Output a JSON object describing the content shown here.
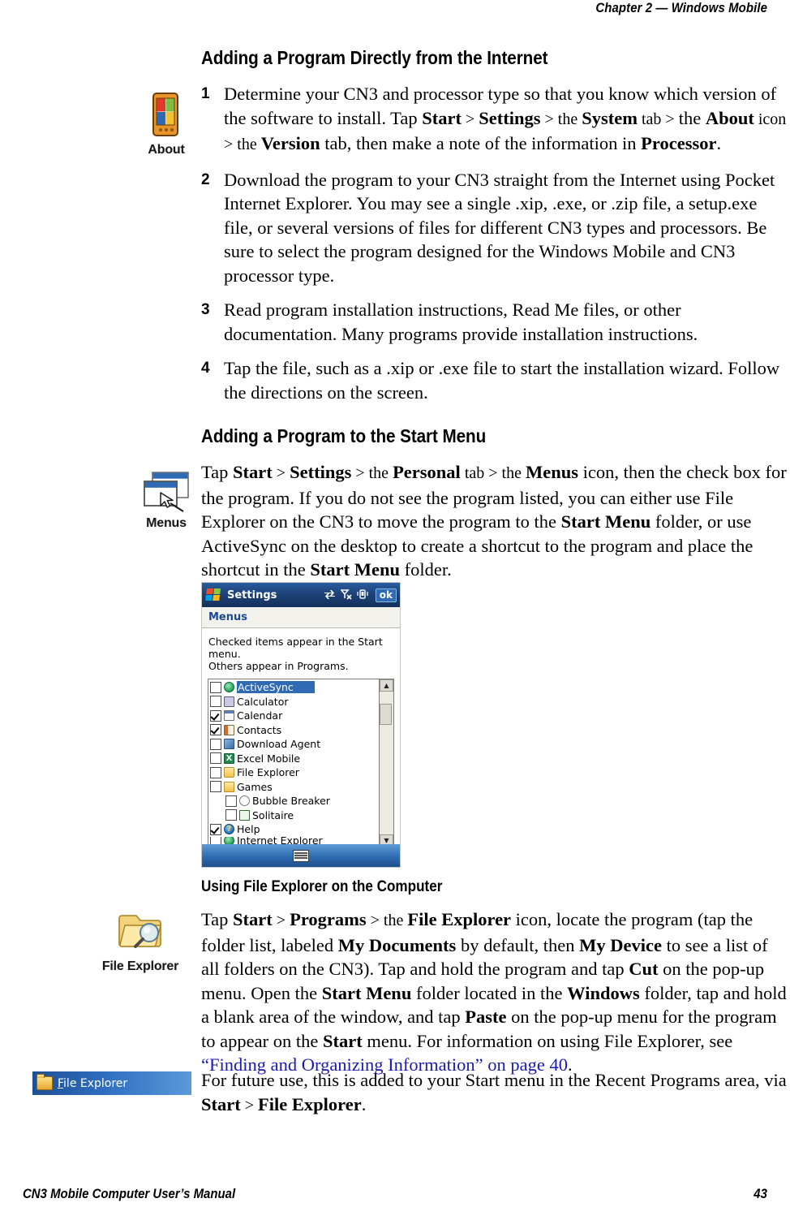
{
  "page": {
    "running_head": "Chapter 2 —  Windows Mobile",
    "footer_title": "CN3 Mobile Computer User’s Manual",
    "footer_page": "43"
  },
  "section1": {
    "heading": "Adding a Program Directly from the Internet",
    "icon_caption": "About",
    "steps": [
      {
        "num": "1",
        "parts": [
          {
            "t": "Determine your CN3 and processor type so that you know which version of the software to install. Tap ",
            "s": "normal"
          },
          {
            "t": "Start",
            "s": "bold"
          },
          {
            "t": " > ",
            "s": "gt"
          },
          {
            "t": "Settings",
            "s": "bold"
          },
          {
            "t": " > the ",
            "s": "gt"
          },
          {
            "t": "System",
            "s": "bold"
          },
          {
            "t": " tab > ",
            "s": "gt"
          },
          {
            "t": "the ",
            "s": "normal"
          },
          {
            "t": "About",
            "s": "bold"
          },
          {
            "t": " icon > the ",
            "s": "gt"
          },
          {
            "t": "Version",
            "s": "bold"
          },
          {
            "t": " tab, then make a note of the information in ",
            "s": "normal"
          },
          {
            "t": "Processor",
            "s": "bold"
          },
          {
            "t": ".",
            "s": "normal"
          }
        ]
      },
      {
        "num": "2",
        "parts": [
          {
            "t": "Download the program to your CN3 straight from the Internet using Pocket Internet Explorer. You may see a single .xip, .exe, or .zip file, a setup.exe file, or several versions of files for different CN3 types and processors. Be sure to select the program designed for the Windows Mobile and CN3 processor type.",
            "s": "normal"
          }
        ]
      },
      {
        "num": "3",
        "parts": [
          {
            "t": "Read program installation instructions, Read Me files, or other documentation. Many programs provide installation instructions.",
            "s": "normal"
          }
        ]
      },
      {
        "num": "4",
        "parts": [
          {
            "t": "Tap the file, such as a .xip or .exe file to start the installation wizard. Follow the directions on the screen.",
            "s": "normal"
          }
        ]
      }
    ]
  },
  "section2": {
    "heading": "Adding a Program to the Start Menu",
    "icon_caption": "Menus",
    "paragraph": [
      {
        "t": "Tap ",
        "s": "normal"
      },
      {
        "t": "Start",
        "s": "bold"
      },
      {
        "t": " > ",
        "s": "gt"
      },
      {
        "t": "Settings",
        "s": "bold"
      },
      {
        "t": " > the ",
        "s": "gt"
      },
      {
        "t": "Personal",
        "s": "bold"
      },
      {
        "t": " tab > the ",
        "s": "gt"
      },
      {
        "t": "Menus",
        "s": "bold"
      },
      {
        "t": " icon, then the check box for the program. If you do not see the program listed, you can either use File Explorer on the CN3 to move the program to the ",
        "s": "normal"
      },
      {
        "t": "Start Menu",
        "s": "bold"
      },
      {
        "t": " folder, or use ActiveSync on the desktop to create a shortcut to the program and place the shortcut in the ",
        "s": "normal"
      },
      {
        "t": "Start Menu",
        "s": "bold"
      },
      {
        "t": " folder.",
        "s": "normal"
      }
    ]
  },
  "pocketpc": {
    "title": "Settings",
    "ok_label": "ok",
    "tray_icons": [
      "activesync-icon",
      "signal-off-icon",
      "volume-icon"
    ],
    "subhead": "Menus",
    "instruction_line1": "Checked items appear in the Start menu.",
    "instruction_line2": "Others appear in Programs.",
    "scroll_up": "▲",
    "scroll_down": "▼",
    "items": [
      {
        "label": "ActiveSync",
        "checked": false,
        "selected": true,
        "indent": false,
        "icon": "ic-activesync",
        "glyph": ""
      },
      {
        "label": "Calculator",
        "checked": false,
        "selected": false,
        "indent": false,
        "icon": "ic-calculator",
        "glyph": ""
      },
      {
        "label": "Calendar",
        "checked": true,
        "selected": false,
        "indent": false,
        "icon": "ic-calendar",
        "glyph": ""
      },
      {
        "label": "Contacts",
        "checked": true,
        "selected": false,
        "indent": false,
        "icon": "ic-contacts",
        "glyph": ""
      },
      {
        "label": "Download Agent",
        "checked": false,
        "selected": false,
        "indent": false,
        "icon": "ic-download",
        "glyph": ""
      },
      {
        "label": "Excel Mobile",
        "checked": false,
        "selected": false,
        "indent": false,
        "icon": "ic-excel",
        "glyph": "X"
      },
      {
        "label": "File Explorer",
        "checked": false,
        "selected": false,
        "indent": false,
        "icon": "ic-folder",
        "glyph": ""
      },
      {
        "label": "Games",
        "checked": false,
        "selected": false,
        "indent": false,
        "icon": "ic-games",
        "glyph": ""
      },
      {
        "label": "Bubble Breaker",
        "checked": false,
        "selected": false,
        "indent": true,
        "icon": "ic-bubble",
        "glyph": ""
      },
      {
        "label": "Solitaire",
        "checked": false,
        "selected": false,
        "indent": true,
        "icon": "ic-solitaire",
        "glyph": ""
      },
      {
        "label": "Help",
        "checked": true,
        "selected": false,
        "indent": false,
        "icon": "ic-help",
        "glyph": "?"
      },
      {
        "label": "Internet Explorer",
        "checked": false,
        "selected": false,
        "indent": false,
        "icon": "ic-activesync",
        "glyph": "",
        "clipped": true
      }
    ]
  },
  "section3": {
    "heading": "Using File Explorer on the Computer",
    "icon_caption": "File Explorer",
    "paragraph": [
      {
        "t": "Tap ",
        "s": "normal"
      },
      {
        "t": "Start",
        "s": "bold"
      },
      {
        "t": " > ",
        "s": "gt"
      },
      {
        "t": "Programs",
        "s": "bold"
      },
      {
        "t": " > the ",
        "s": "gt"
      },
      {
        "t": "File Explorer",
        "s": "bold"
      },
      {
        "t": " icon, locate the program (tap the folder list, labeled ",
        "s": "normal"
      },
      {
        "t": "My Documents",
        "s": "bold"
      },
      {
        "t": " by default, then ",
        "s": "normal"
      },
      {
        "t": "My Device",
        "s": "bold"
      },
      {
        "t": " to see a list of all folders on the CN3). Tap and hold the program and tap ",
        "s": "normal"
      },
      {
        "t": "Cut",
        "s": "bold"
      },
      {
        "t": " on the pop-up menu. Open the ",
        "s": "normal"
      },
      {
        "t": "Start Menu",
        "s": "bold"
      },
      {
        "t": " folder located in the ",
        "s": "normal"
      },
      {
        "t": "Windows",
        "s": "bold"
      },
      {
        "t": " folder, tap and hold a blank area of the window, and tap ",
        "s": "normal"
      },
      {
        "t": "Paste",
        "s": "bold"
      },
      {
        "t": " on the pop-up menu for the program to appear on the ",
        "s": "normal"
      },
      {
        "t": "Start",
        "s": "bold"
      },
      {
        "t": " menu. For information on using File Explorer, see ",
        "s": "normal"
      },
      {
        "t": "“Finding and Organizing Information” on page 40",
        "s": "xref"
      },
      {
        "t": ".",
        "s": "normal"
      }
    ],
    "start_menu_item": {
      "label_underlined": "F",
      "label_rest": "ile Explorer"
    },
    "paragraph2": [
      {
        "t": "For future use, this is added to your Start menu in the Recent Programs area, via ",
        "s": "normal"
      },
      {
        "t": "Start",
        "s": "bold"
      },
      {
        "t": " > ",
        "s": "gt"
      },
      {
        "t": "File Explorer",
        "s": "bold"
      },
      {
        "t": ".",
        "s": "normal"
      }
    ]
  },
  "colors": {
    "xref_blue": "#1a1ab4",
    "ppc_titlebar": "#1d4278",
    "ppc_select": "#2f6bb5",
    "ppc_subhead_text": "#1b4a8c",
    "taskbar": "#2f6cb2"
  }
}
